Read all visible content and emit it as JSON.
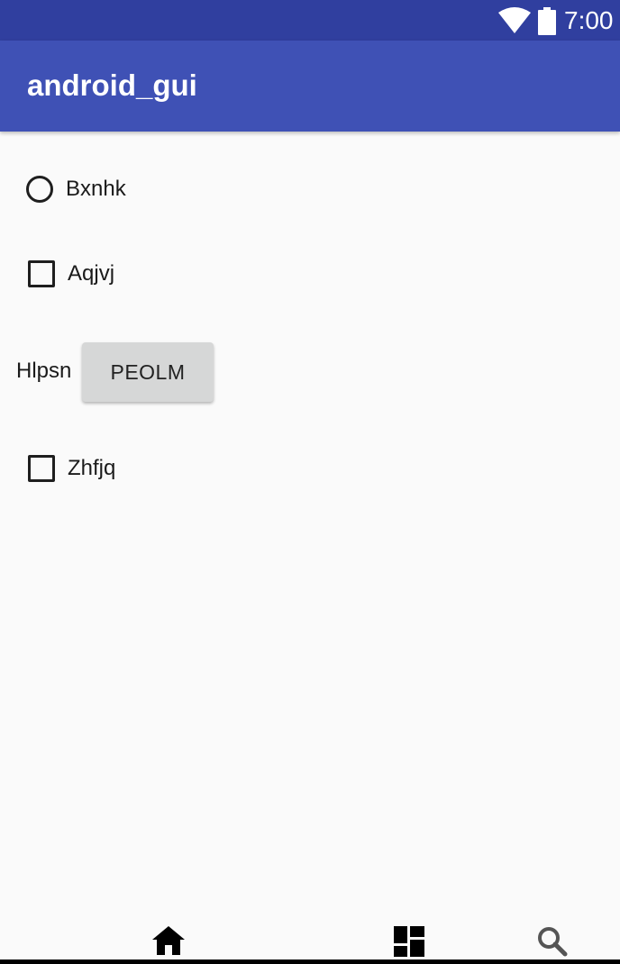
{
  "status_bar": {
    "time": "7:00",
    "icons": [
      "wifi-icon",
      "battery-icon"
    ],
    "background": "#303f9f"
  },
  "app_bar": {
    "title": "android_gui",
    "background": "#3f51b5"
  },
  "content": {
    "radio_option": {
      "label": "Bxnhk",
      "checked": false
    },
    "checkbox_1": {
      "label": "Aqjvj",
      "checked": false
    },
    "field_label": "Hlpsn",
    "button_label": "PEOLM",
    "checkbox_2": {
      "label": "Zhfjq",
      "checked": false
    }
  },
  "nav_bar": {
    "items": [
      "home-icon",
      "dashboard-icon",
      "search-icon"
    ]
  }
}
